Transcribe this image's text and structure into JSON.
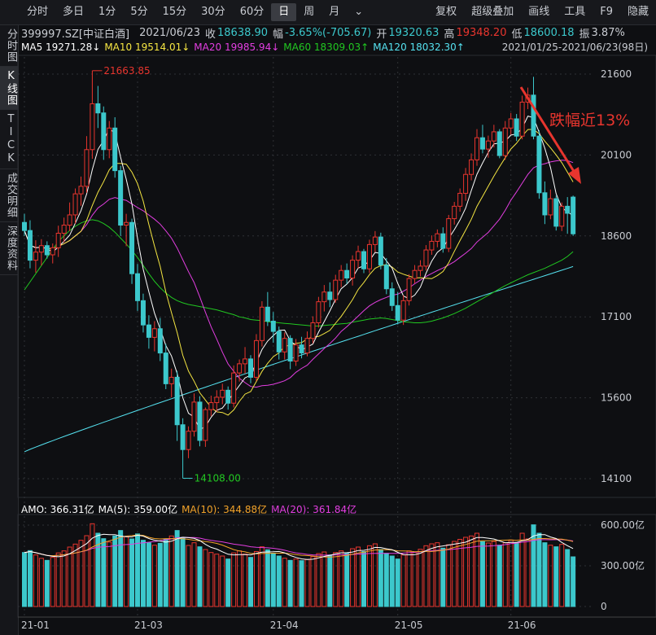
{
  "toolbar": {
    "left": [
      "分时",
      "多日",
      "1分",
      "5分",
      "15分",
      "30分",
      "60分",
      "日",
      "周",
      "月"
    ],
    "active": "日",
    "dropdown_icon": "chevron-down-icon",
    "right": [
      "复权",
      "超级叠加",
      "画线",
      "工具",
      "F9",
      "隐藏"
    ]
  },
  "sidebar": {
    "tabs": [
      "分时图",
      "K线图",
      "TICK",
      "成交明细",
      "深度资料"
    ],
    "active": "K线图"
  },
  "info": {
    "code": "399997.SZ[中证白酒]",
    "date": "2021/06/23",
    "close_label": "收",
    "close": "18638.90",
    "change_label": "幅",
    "change": "-3.65%(-705.67)",
    "open_label": "开",
    "open": "19320.63",
    "high_label": "高",
    "high": "19348.20",
    "low_label": "低",
    "low": "18600.18",
    "amp_label": "振",
    "amp": "3.87%"
  },
  "ma_legend": {
    "ma5": "MA5 19271.28↓",
    "ma10": "MA10 19514.01↓",
    "ma20": "MA20 19985.94↓",
    "ma60": "MA60 18309.03↑",
    "ma120": "MA120 18032.30↑",
    "range": "2021/01/25-2021/06/23(98日)"
  },
  "volume_legend": {
    "amo": "AMO: 366.31亿",
    "ma5": "MA(5): 359.00亿",
    "ma10": "MA(10): 344.88亿",
    "ma20": "MA(20): 361.84亿"
  },
  "annotation": "跌幅近13%",
  "colors": {
    "up": "#e8352e",
    "down": "#3cc8cc",
    "ma5": "#ffffff",
    "ma10": "#f5e642",
    "ma20": "#e23ee0",
    "ma60": "#21c721",
    "ma120": "#55e2f0",
    "vol_ma10": "#f2a32a"
  },
  "chart_data": [
    {
      "type": "candlestick",
      "price_ylim": [
        14100,
        21600
      ],
      "y_ticks": [
        "21600",
        "20100",
        "18600",
        "17100",
        "15600",
        "14100"
      ],
      "x_ticks": [
        "21-01",
        "21-03",
        "21-04",
        "21-05",
        "21-06"
      ],
      "markers": {
        "high_label": "21663.85",
        "low_label": "14108.00"
      },
      "ohlc": [
        [
          18850,
          19010,
          18600,
          18700
        ],
        [
          18700,
          18890,
          18000,
          18150
        ],
        [
          18150,
          18520,
          17920,
          18300
        ],
        [
          18300,
          18540,
          18050,
          18420
        ],
        [
          18420,
          18500,
          18180,
          18250
        ],
        [
          18250,
          18460,
          18090,
          18380
        ],
        [
          18380,
          18790,
          18210,
          18650
        ],
        [
          18650,
          18940,
          18480,
          18800
        ],
        [
          18800,
          19220,
          18690,
          18990
        ],
        [
          18990,
          19480,
          18830,
          19380
        ],
        [
          19380,
          19700,
          19160,
          19520
        ],
        [
          19520,
          20450,
          19400,
          20200
        ],
        [
          20200,
          21663,
          20030,
          21050
        ],
        [
          21050,
          21380,
          20600,
          20880
        ],
        [
          20880,
          21000,
          20010,
          20200
        ],
        [
          20200,
          20730,
          20040,
          20600
        ],
        [
          20600,
          20800,
          19680,
          19810
        ],
        [
          19810,
          19900,
          18600,
          18800
        ],
        [
          18800,
          19010,
          18410,
          18850
        ],
        [
          18850,
          18920,
          17710,
          17900
        ],
        [
          17900,
          18080,
          17210,
          17400
        ],
        [
          17400,
          17530,
          16810,
          16950
        ],
        [
          16950,
          17130,
          16510,
          16720
        ],
        [
          16720,
          17020,
          16460,
          16880
        ],
        [
          16880,
          17080,
          16280,
          16430
        ],
        [
          16430,
          16600,
          15760,
          15860
        ],
        [
          15860,
          16140,
          15610,
          15980
        ],
        [
          15980,
          16100,
          14800,
          15100
        ],
        [
          15100,
          15220,
          14108,
          14640
        ],
        [
          14640,
          15070,
          14480,
          14980
        ],
        [
          14980,
          15680,
          14880,
          15520
        ],
        [
          15520,
          15630,
          14700,
          14810
        ],
        [
          14810,
          15420,
          14690,
          15380
        ],
        [
          15380,
          15640,
          15260,
          15510
        ],
        [
          15510,
          15740,
          15340,
          15610
        ],
        [
          15610,
          15860,
          15480,
          15740
        ],
        [
          15740,
          15810,
          15380,
          15500
        ],
        [
          15500,
          16200,
          15420,
          16060
        ],
        [
          16060,
          16310,
          15900,
          16230
        ],
        [
          16230,
          16540,
          16050,
          16320
        ],
        [
          16320,
          16390,
          15870,
          15980
        ],
        [
          15980,
          16780,
          15910,
          16660
        ],
        [
          16660,
          17390,
          16550,
          17280
        ],
        [
          17280,
          17560,
          16930,
          17020
        ],
        [
          17020,
          17190,
          16620,
          16830
        ],
        [
          16830,
          16920,
          16310,
          16450
        ],
        [
          16450,
          16810,
          16310,
          16700
        ],
        [
          16700,
          16760,
          16130,
          16280
        ],
        [
          16280,
          16690,
          16190,
          16580
        ],
        [
          16580,
          16730,
          16330,
          16430
        ],
        [
          16430,
          16830,
          16370,
          16700
        ],
        [
          16700,
          17110,
          16610,
          16990
        ],
        [
          16990,
          17470,
          16900,
          17380
        ],
        [
          17380,
          17690,
          17200,
          17560
        ],
        [
          17560,
          17740,
          17280,
          17420
        ],
        [
          17420,
          17880,
          17360,
          17780
        ],
        [
          17780,
          18060,
          17650,
          17960
        ],
        [
          17960,
          18090,
          17710,
          17820
        ],
        [
          17820,
          18240,
          17680,
          18150
        ],
        [
          18150,
          18420,
          18000,
          18310
        ],
        [
          18310,
          18360,
          17910,
          17990
        ],
        [
          17990,
          18530,
          17910,
          18440
        ],
        [
          18440,
          18690,
          18300,
          18580
        ],
        [
          18580,
          18660,
          17980,
          18060
        ],
        [
          18060,
          18190,
          17520,
          17620
        ],
        [
          17620,
          17740,
          17210,
          17310
        ],
        [
          17310,
          17560,
          16960,
          17040
        ],
        [
          17040,
          17500,
          16950,
          17400
        ],
        [
          17400,
          17890,
          17310,
          17810
        ],
        [
          17810,
          18060,
          17720,
          17960
        ],
        [
          17960,
          18150,
          17850,
          18040
        ],
        [
          18040,
          18430,
          17960,
          18340
        ],
        [
          18340,
          18610,
          18250,
          18500
        ],
        [
          18500,
          18720,
          18390,
          18640
        ],
        [
          18640,
          18760,
          18290,
          18370
        ],
        [
          18370,
          18990,
          18300,
          18920
        ],
        [
          18920,
          19230,
          18810,
          19150
        ],
        [
          19150,
          19480,
          19050,
          19390
        ],
        [
          19390,
          19860,
          19250,
          19740
        ],
        [
          19740,
          20130,
          19630,
          20010
        ],
        [
          20010,
          20580,
          19900,
          20420
        ],
        [
          20420,
          20660,
          20130,
          20210
        ],
        [
          20210,
          20460,
          20050,
          20360
        ],
        [
          20360,
          20660,
          20240,
          20530
        ],
        [
          20530,
          20580,
          20040,
          20090
        ],
        [
          20090,
          20730,
          20010,
          20600
        ],
        [
          20600,
          20880,
          20480,
          20770
        ],
        [
          20770,
          20860,
          20360,
          20450
        ],
        [
          20450,
          21200,
          20390,
          21080
        ],
        [
          21080,
          21350,
          20950,
          21210
        ],
        [
          21210,
          21550,
          20390,
          20450
        ],
        [
          20450,
          20560,
          19290,
          19400
        ],
        [
          19400,
          19610,
          18820,
          18990
        ],
        [
          18990,
          19460,
          18910,
          19290
        ],
        [
          19290,
          19350,
          18700,
          18780
        ],
        [
          18780,
          19220,
          18690,
          19150
        ],
        [
          19150,
          19320,
          18640,
          19020
        ],
        [
          19320,
          19348,
          18600,
          18639
        ]
      ]
    },
    {
      "type": "bar",
      "ylim": [
        0,
        600
      ],
      "y_ticks": [
        "600.00亿",
        "300.00亿",
        "0"
      ],
      "unit": "亿",
      "values": [
        398,
        412,
        380,
        355,
        340,
        362,
        395,
        410,
        438,
        460,
        488,
        522,
        610,
        540,
        500,
        475,
        520,
        560,
        515,
        498,
        535,
        488,
        470,
        452,
        466,
        498,
        520,
        560,
        510,
        450,
        470,
        440,
        420,
        398,
        386,
        372,
        350,
        395,
        410,
        386,
        362,
        405,
        440,
        418,
        392,
        372,
        356,
        340,
        350,
        338,
        346,
        368,
        390,
        402,
        380,
        398,
        410,
        392,
        426,
        438,
        405,
        448,
        462,
        420,
        392,
        372,
        350,
        380,
        410,
        400,
        422,
        448,
        462,
        470,
        430,
        455,
        480,
        495,
        510,
        520,
        540,
        478,
        468,
        480,
        452,
        470,
        490,
        470,
        540,
        498,
        602,
        540,
        470,
        452,
        440,
        458,
        420,
        366
      ]
    }
  ]
}
